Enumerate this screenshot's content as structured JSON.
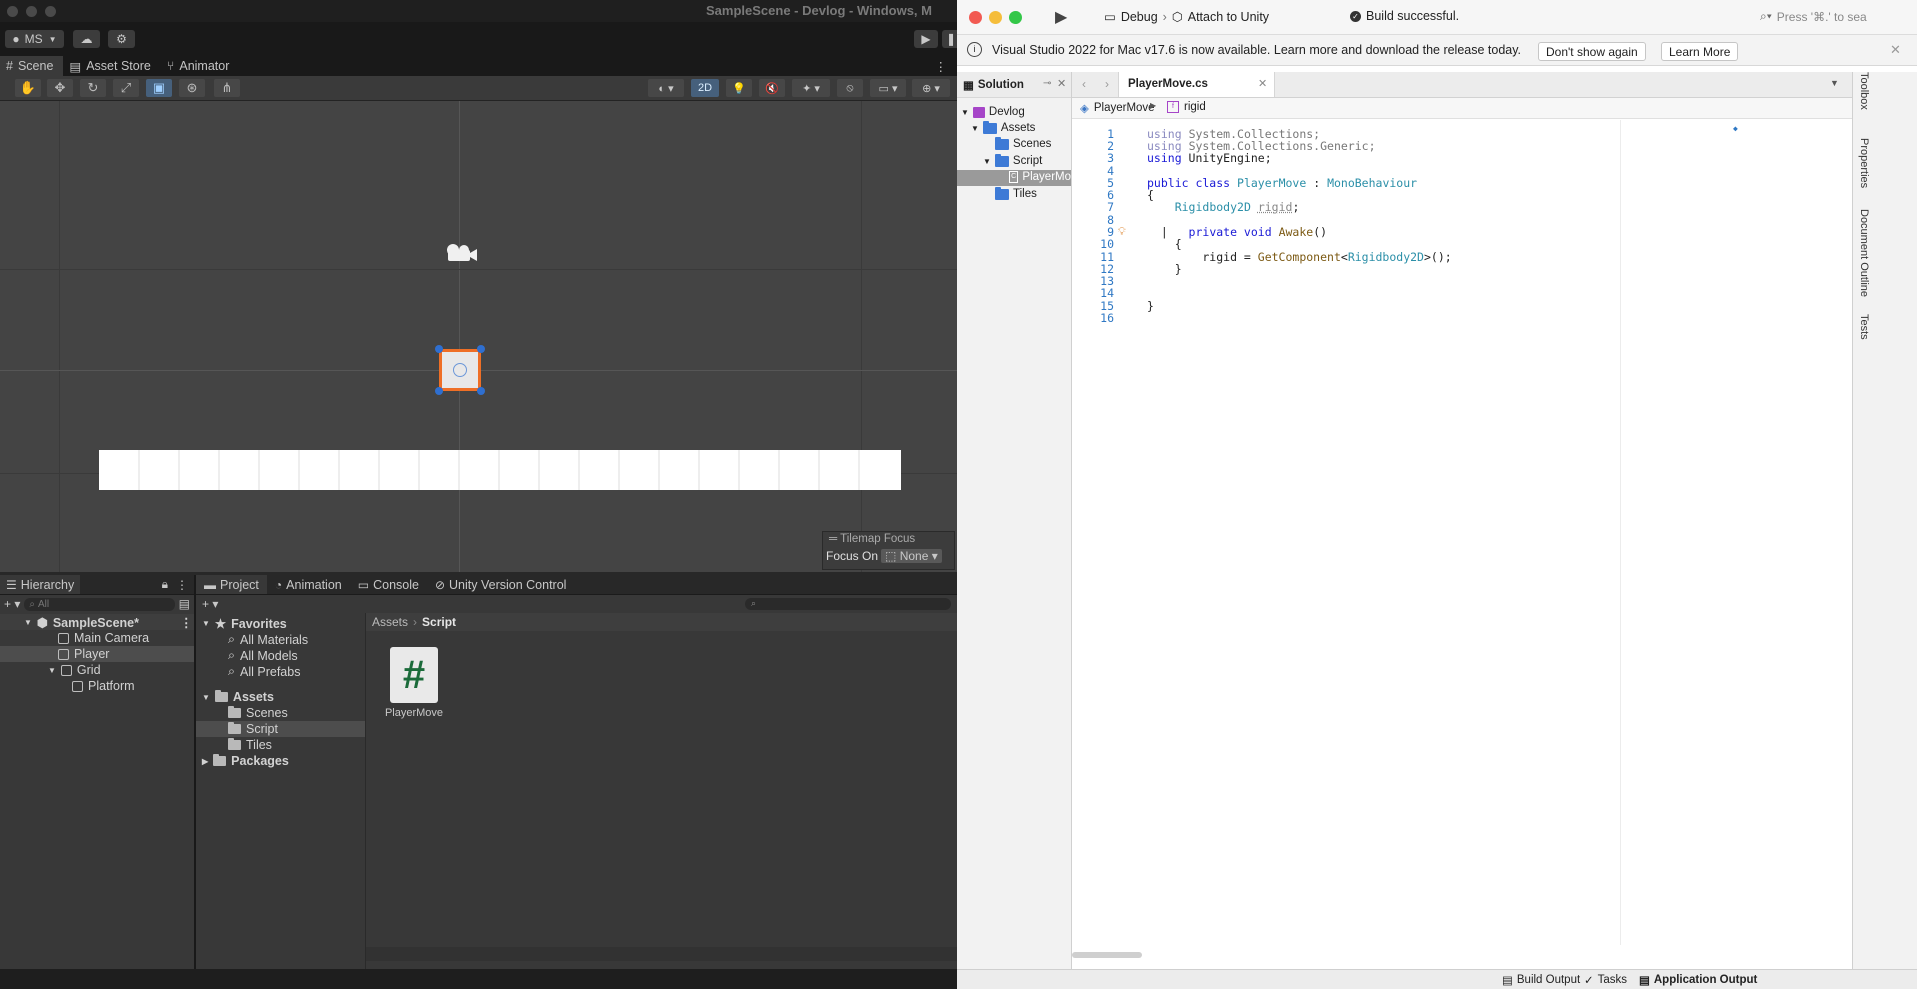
{
  "unity": {
    "window_title": "SampleScene - Devlog - Windows, M",
    "account_label": "MS",
    "tabs": [
      {
        "label": "Scene",
        "icon": "grid-icon"
      },
      {
        "label": "Asset Store",
        "icon": "store-icon"
      },
      {
        "label": "Animator",
        "icon": "animator-icon"
      }
    ],
    "scene_toolbar": {
      "mode_2d": "2D"
    },
    "tilemap_overlay": {
      "title": "Tilemap Focus",
      "focus_label": "Focus On",
      "focus_value": "None"
    },
    "hierarchy": {
      "tab": "Hierarchy",
      "search_placeholder": "All",
      "scene": "SampleScene*",
      "items": [
        "Main Camera",
        "Player",
        "Grid",
        "Platform"
      ]
    },
    "bottom_tabs": [
      "Project",
      "Animation",
      "Console",
      "Unity Version Control"
    ],
    "project": {
      "favorites_label": "Favorites",
      "favorites": [
        "All Materials",
        "All Models",
        "All Prefabs"
      ],
      "assets_label": "Assets",
      "asset_folders": [
        "Scenes",
        "Script",
        "Tiles"
      ],
      "packages_label": "Packages",
      "breadcrumb": [
        "Assets",
        "Script"
      ],
      "files": [
        {
          "name": "PlayerMove",
          "glyph": "#"
        }
      ]
    }
  },
  "vs": {
    "run_config": "Debug",
    "target": "Attach to Unity",
    "build_status": "Build successful.",
    "search_placeholder": "Press '⌘.' to sea",
    "info_bar": {
      "message": "Visual Studio 2022 for Mac v17.6 is now available. Learn more and download the release today.",
      "dismiss_label": "Don't show again",
      "learn_label": "Learn More"
    },
    "solution": {
      "title": "Solution",
      "items": [
        "Devlog",
        "Assets",
        "Scenes",
        "Script",
        "PlayerMo",
        "Tiles"
      ]
    },
    "editor": {
      "tab": "PlayerMove.cs",
      "breadcrumb_class": "PlayerMove",
      "breadcrumb_member": "rigid",
      "line_numbers": [
        "1",
        "2",
        "3",
        "4",
        "5",
        "6",
        "7",
        "8",
        "9",
        "10",
        "11",
        "12",
        "13",
        "14",
        "15",
        "16"
      ]
    },
    "right_rail": [
      "Toolbox",
      "Properties",
      "Document Outline",
      "Tests"
    ],
    "status": {
      "build_output": "Build Output",
      "tasks": "Tasks",
      "app_output": "Application Output"
    },
    "colors": {
      "keyword": "#1a1ad6",
      "type": "#2b8fa8",
      "line_number": "#2f78c4"
    }
  }
}
